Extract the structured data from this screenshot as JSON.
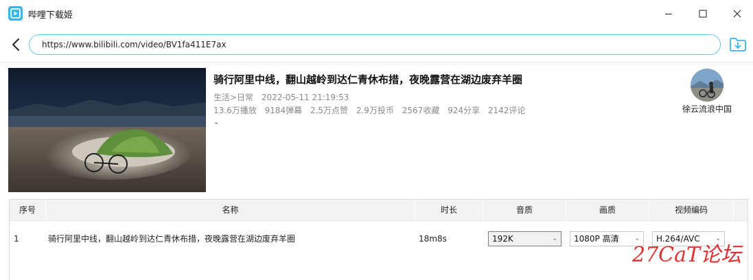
{
  "window": {
    "title": "哔哩下载姬",
    "app_icon": "play-logo-icon",
    "accent_color": "#39b5e8"
  },
  "address_bar": {
    "url": "https://www.bilibili.com/video/BV1fa411E7ax"
  },
  "video": {
    "title": "骑行阿里中线，翻山越岭到达仁青休布措，夜晚露营在湖边废弃羊圈",
    "category": "生活>日常",
    "publish_time": "2022-05-11 21:19:53",
    "stats": {
      "plays": "13.6万播放",
      "danmaku": "9184弹幕",
      "likes": "2.5万点赞",
      "coins": "2.9万投币",
      "favorites": "2567收藏",
      "shares": "924分享",
      "comments": "2142评论"
    },
    "description": "-",
    "uploader": "徐云流浪中国"
  },
  "table": {
    "headers": {
      "index": "序号",
      "name": "名称",
      "duration": "时长",
      "audio_quality": "音质",
      "video_quality": "画质",
      "video_codec": "视频编码"
    },
    "rows": [
      {
        "index": "1",
        "name": "骑行阿里中线，翻山越岭到达仁青休布措，夜晚露营在湖边废弃羊圈",
        "duration": "18m8s",
        "audio_quality": "192K",
        "video_quality": "1080P 高清",
        "video_codec": "H.264/AVC"
      }
    ]
  },
  "watermark": "27CaT论坛"
}
